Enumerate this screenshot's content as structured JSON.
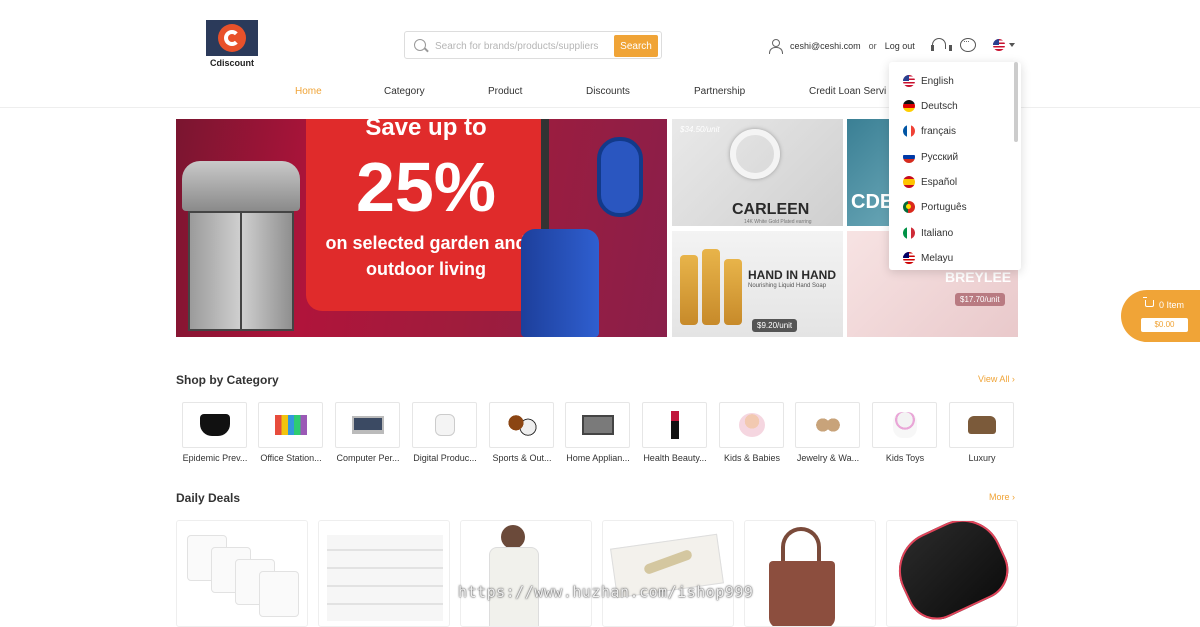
{
  "header": {
    "logo_text": "Cdiscount",
    "search": {
      "placeholder": "Search for brands/products/suppliers",
      "button_label": "Search"
    },
    "user": {
      "email": "ceshi@ceshi.com",
      "or_text": "or",
      "logout_label": "Log out"
    }
  },
  "nav": {
    "items": [
      {
        "label": "Home",
        "active": true
      },
      {
        "label": "Category"
      },
      {
        "label": "Product"
      },
      {
        "label": "Discounts"
      },
      {
        "label": "Partnership"
      },
      {
        "label": "Credit Loan Servi"
      }
    ]
  },
  "language_menu": {
    "items": [
      "English",
      "Deutsch",
      "français",
      "Русский",
      "Español",
      "Português",
      "Italiano",
      "Melayu"
    ]
  },
  "banner": {
    "line1": "Save up to",
    "percent": "25%",
    "line3": "on selected garden and outdoor living",
    "tiles": [
      {
        "price": "$34.50",
        "unit": "/unit",
        "title": "CARLEEN",
        "subtitle": "14K White Gold Plated earring"
      },
      {
        "title": "CDE"
      },
      {
        "title": "HAND IN HAND",
        "subtitle": "Nourishing Liquid Hand Soap",
        "price": "$9.20",
        "unit": "/unit"
      },
      {
        "title": "BREYLEE",
        "price": "$17.70",
        "unit": "/unit"
      }
    ]
  },
  "cart": {
    "count_label": "0 Item",
    "total": "$0.00"
  },
  "shop_by_category": {
    "title": "Shop by Category",
    "view_all": "View All",
    "items": [
      "Epidemic Prev...",
      "Office Station...",
      "Computer Per...",
      "Digital Produc...",
      "Sports & Out...",
      "Home Applian...",
      "Health Beauty...",
      "Kids & Babies",
      "Jewelry & Wa...",
      "Kids Toys",
      "Luxury"
    ]
  },
  "daily_deals": {
    "title": "Daily Deals",
    "more": "More"
  },
  "watermark": "https://www.huzhan.com/ishop999",
  "colors": {
    "accent": "#f0a437",
    "banner_red": "#e02b2b",
    "logo_navy": "#2b3a5a",
    "logo_orange": "#e8512a"
  }
}
